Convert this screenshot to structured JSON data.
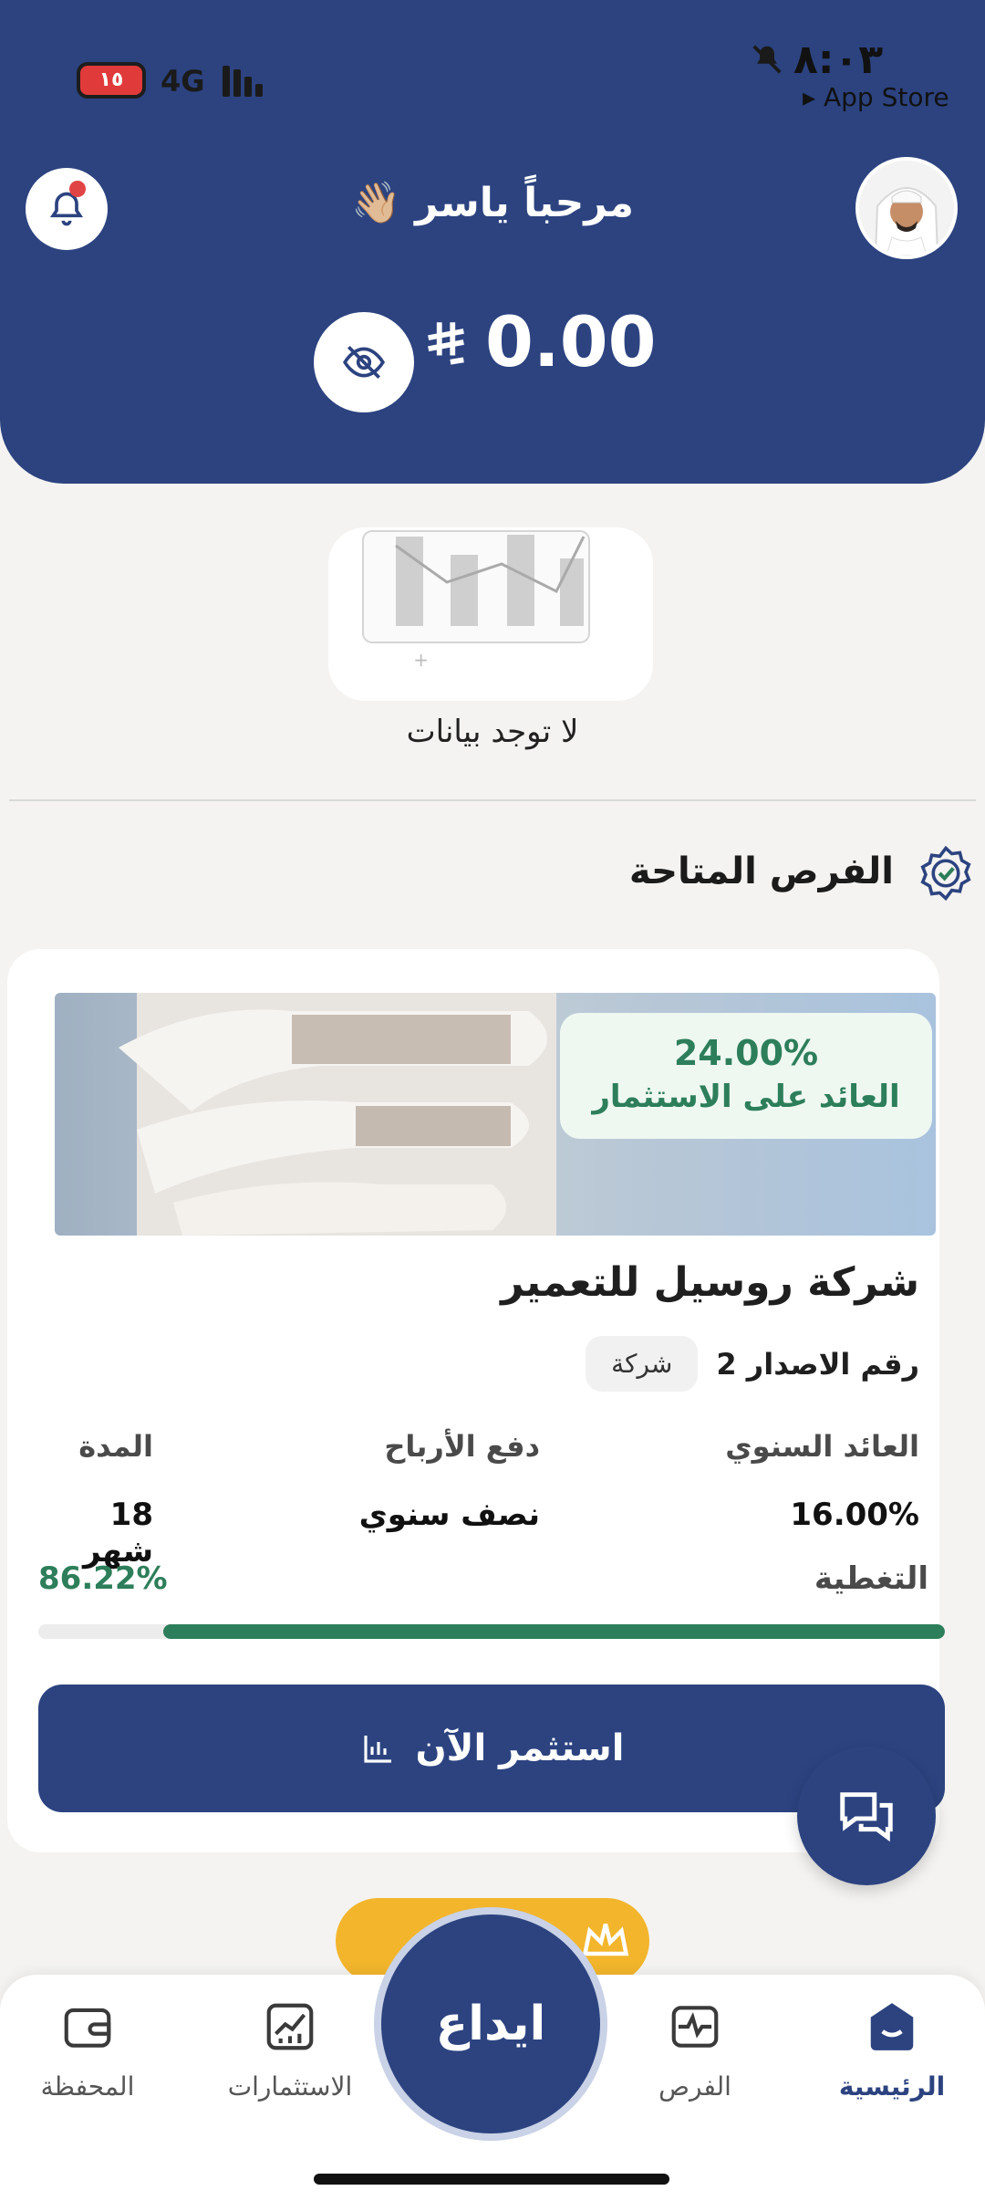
{
  "status_bar": {
    "time": "٨:٠٣",
    "back_app": "App Store",
    "battery": "١٥",
    "network": "4G"
  },
  "header": {
    "greeting": "مرحباً ياسر 👋🏼",
    "balance": "0.00",
    "currency_icon": "riyal-icon",
    "accent_color": "#2c4380"
  },
  "empty_state": {
    "text": "لا توجد بيانات"
  },
  "section": {
    "title": "الفرص المتاحة"
  },
  "opportunity": {
    "roi_value": "24.00%",
    "roi_label": "العائد على الاستثمار",
    "company": "شركة روسيل للتعمير",
    "issue_number": "رقم الاصدار 2",
    "type": "شركة",
    "stats": [
      {
        "label": "العائد السنوي",
        "value": "16.00%"
      },
      {
        "label": "دفع الأرباح",
        "value": "نصف سنوي"
      },
      {
        "label": "المدة",
        "value": "18 شهر"
      }
    ],
    "coverage_label": "التغطية",
    "coverage_value": "86.22%",
    "coverage_fraction": 0.8622,
    "invest_label": "استثمر الآن"
  },
  "bottom_nav": {
    "items": [
      {
        "label": "الرئيسية",
        "icon": "home-icon",
        "active": true
      },
      {
        "label": "الفرص",
        "icon": "opportunities-icon",
        "active": false
      },
      {
        "label": "الاستثمارات",
        "icon": "investments-chart-icon",
        "active": false
      },
      {
        "label": "المحفظة",
        "icon": "wallet-icon",
        "active": false
      }
    ],
    "deposit_label": "ايداع"
  }
}
